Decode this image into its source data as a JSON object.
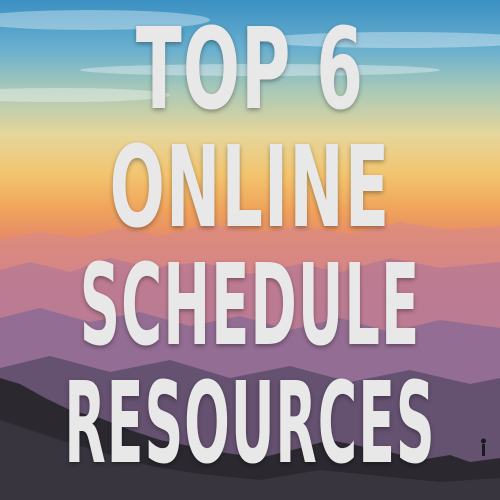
{
  "title": {
    "line1": "TOP 6",
    "line2": "ONLINE",
    "line3": "SCHEDULE",
    "line4": "RESOURCES"
  },
  "colors": {
    "sky_top": "#3a90c2",
    "sunset_yellow": "#f3c46e",
    "mountain_pink": "#c97a8c",
    "mountain_purple": "#8e6e9c",
    "foreground_dark": "#222025",
    "text": "#e8e8e8"
  }
}
